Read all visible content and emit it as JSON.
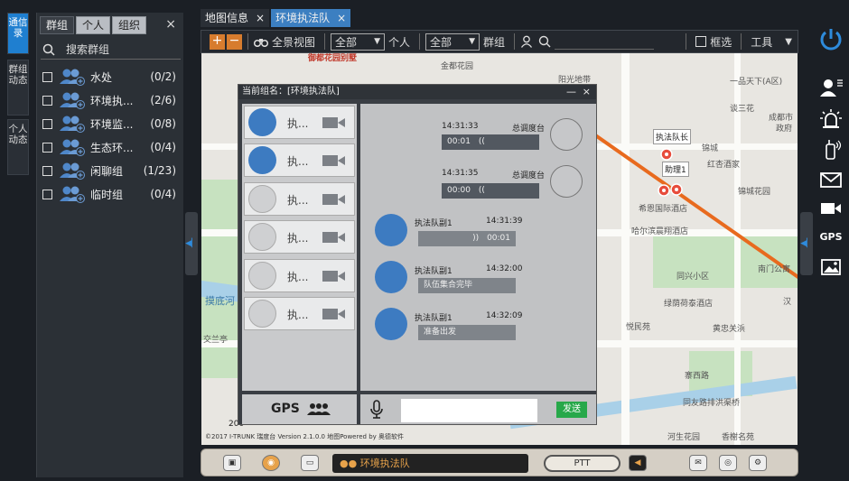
{
  "vtabs": [
    {
      "label": "通信录",
      "active": true
    },
    {
      "label": "群组动态",
      "active": false
    },
    {
      "label": "个人动态",
      "active": false
    }
  ],
  "group_panel": {
    "tabs": [
      {
        "label": "群组",
        "active": true
      },
      {
        "label": "个人",
        "active": false
      },
      {
        "label": "组织",
        "active": false
      }
    ],
    "close": "×",
    "search_label": "搜索群组",
    "groups": [
      {
        "name": "水处",
        "count": "(0/2)"
      },
      {
        "name": "环境执...",
        "count": "(2/6)"
      },
      {
        "name": "环境监...",
        "count": "(0/8)"
      },
      {
        "name": "生态环...",
        "count": "(0/4)"
      },
      {
        "name": "闲聊组",
        "count": "(1/23)"
      },
      {
        "name": "临时组",
        "count": "(0/4)"
      }
    ]
  },
  "map_tabs": [
    {
      "label": "地图信息",
      "active": false
    },
    {
      "label": "环境执法队",
      "active": true
    }
  ],
  "toolbar": {
    "panorama": "全景视图",
    "filter1_value": "全部",
    "personal": "个人",
    "filter2_value": "全部",
    "group": "群组",
    "select_box": "框选",
    "tools": "工具"
  },
  "map": {
    "labels": [
      "御都花园别墅",
      "金都花园",
      "阳光地带",
      "一品天下(A区)",
      "谈三花",
      "成都市",
      "政府",
      "执法队长",
      "红杏酒家",
      "锦城花园",
      "希恩国际酒店",
      "哈尔滨晨翔酒店",
      "助理1",
      "锦城",
      "南门公寓",
      "同兴小区",
      "绿荫荷泰酒店",
      "悦民苑",
      "黄忠关浜",
      "摸底河",
      "交兰亭",
      "寨西路",
      "同友路排洪渠桥",
      "河生花园",
      "香榭名苑",
      "汉"
    ],
    "copyright": "©2017 I-TRUNK 瑞度台  Version 2.1.0.0 地图Powered by 奥德软件",
    "scale": "200"
  },
  "chat": {
    "title": "当前组名：[环境执法队]",
    "minimize": "—",
    "close": "×",
    "members": [
      {
        "name": "执...",
        "online": true
      },
      {
        "name": "执...",
        "online": true
      },
      {
        "name": "执...",
        "online": false
      },
      {
        "name": "执...",
        "online": false
      },
      {
        "name": "执...",
        "online": false
      },
      {
        "name": "执...",
        "online": false
      }
    ],
    "messages": [
      {
        "dir": "out",
        "time": "14:31:33",
        "sender": "总调度台",
        "content": "00:01",
        "type": "voice"
      },
      {
        "dir": "out",
        "time": "14:31:35",
        "sender": "总调度台",
        "content": "00:00",
        "type": "voice"
      },
      {
        "dir": "in",
        "time": "14:31:39",
        "sender": "执法队副1",
        "content": "00:01",
        "type": "voice"
      },
      {
        "dir": "in",
        "time": "14:32:00",
        "sender": "执法队副1",
        "content": "队伍集合完毕",
        "type": "text"
      },
      {
        "dir": "in",
        "time": "14:32:09",
        "sender": "执法队副1",
        "content": "准备出发",
        "type": "text"
      }
    ],
    "footer_gps": "GPS",
    "send": "发送"
  },
  "right_tools": {
    "gps": "GPS"
  },
  "bottom_bar": {
    "channel": "环境执法队",
    "ptt": "PTT"
  },
  "colors": {
    "accent": "#1f7fd0",
    "orange": "#d77c2e",
    "send_green": "#27a84a",
    "avatar_blue": "#3d7bc1"
  }
}
